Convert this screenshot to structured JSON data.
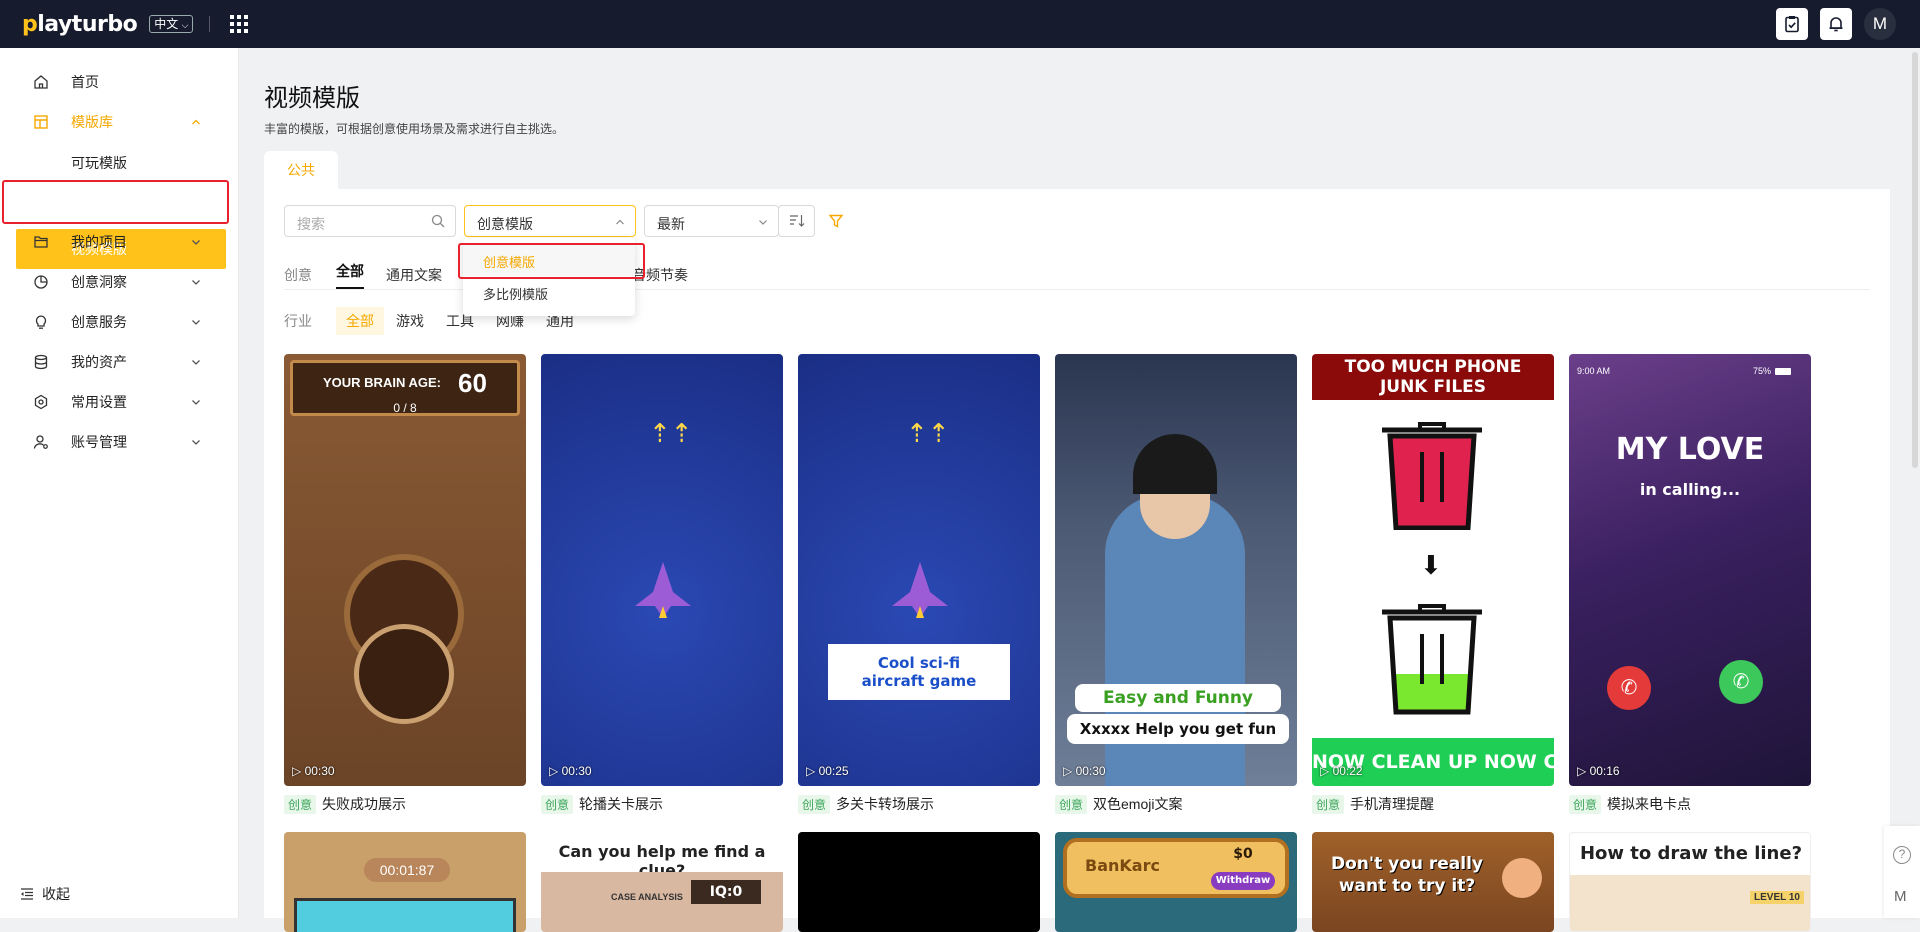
{
  "topbar": {
    "logo_text": "playturbo",
    "lang_label": "中文",
    "avatar_letter": "M"
  },
  "sidebar": {
    "items": [
      {
        "label": "首页",
        "icon": "home-icon"
      },
      {
        "label": "模版库",
        "icon": "template-icon"
      },
      {
        "label": "我的项目",
        "icon": "folder-icon"
      },
      {
        "label": "创意洞察",
        "icon": "pie-chart-icon"
      },
      {
        "label": "创意服务",
        "icon": "bulb-icon"
      },
      {
        "label": "我的资产",
        "icon": "database-icon"
      },
      {
        "label": "常用设置",
        "icon": "settings-icon"
      },
      {
        "label": "账号管理",
        "icon": "user-settings-icon"
      }
    ],
    "sub_items": [
      "可玩模版",
      "视频模版"
    ],
    "collapse_label": "收起",
    "accent": "#ffc21a"
  },
  "page": {
    "title": "视频模版",
    "description": "丰富的模版，可根据创意使用场景及需求进行自主挑选。",
    "tab": "公共"
  },
  "filters": {
    "search_placeholder": "搜索",
    "type_select": "创意模版",
    "sort_select": "最新",
    "dropdown_options": [
      "创意模版",
      "多比例模版"
    ],
    "creative_label": "创意",
    "creative_chips": [
      "全部",
      "通用文案",
      "音频节奏"
    ],
    "industry_label": "行业",
    "industry_chips": [
      "全部",
      "游戏",
      "工具",
      "网赚",
      "通用"
    ]
  },
  "cards": [
    {
      "duration": "00:30",
      "tag": "创意",
      "title": "失败成功展示",
      "overlay": [
        "YOUR BRAIN AGE:",
        "60",
        "0 / 8"
      ]
    },
    {
      "duration": "00:30",
      "tag": "创意",
      "title": "轮播关卡展示"
    },
    {
      "duration": "00:25",
      "tag": "创意",
      "title": "多关卡转场展示",
      "overlay": [
        "Cool sci-fi",
        "aircraft game"
      ]
    },
    {
      "duration": "00:30",
      "tag": "创意",
      "title": "双色emoji文案",
      "overlay": [
        "Easy and Funny",
        "Xxxxx Help you get fun"
      ]
    },
    {
      "duration": "00:22",
      "tag": "创意",
      "title": "手机清理提醒",
      "overlay": [
        "TOO MUCH PHONE",
        "JUNK FILES",
        "NOW   CLEAN UP NOW   C"
      ]
    },
    {
      "duration": "00:16",
      "tag": "创意",
      "title": "模拟来电卡点",
      "overlay": [
        "9:00 AM",
        "75%",
        "MY LOVE",
        "in calling..."
      ]
    }
  ],
  "row2": [
    {
      "text": "00:01:87"
    },
    {
      "text": "Can you help me find a clue?",
      "sub": "CASE ANALYSIS",
      "sub2": "IQ:0"
    },
    {
      "text": ""
    },
    {
      "text": "BanKarc",
      "sub": "$0",
      "sub2": "Withdraw"
    },
    {
      "text": "Don't you really",
      "sub": "want to try it?"
    },
    {
      "text": "How to draw the line?",
      "sub": "LEVEL 10"
    }
  ]
}
